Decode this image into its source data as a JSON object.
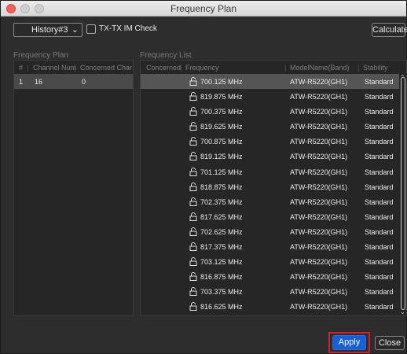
{
  "window": {
    "title": "Frequency Plan"
  },
  "toolbar": {
    "history_value": "History#3",
    "im_check_label": "TX-TX IM Check",
    "im_check_checked": false,
    "calculate_label": "Calculate"
  },
  "plan": {
    "section_label": "Frequency Plan",
    "columns": [
      "#",
      "Channel Num",
      "Concerned Channe"
    ],
    "rows": [
      {
        "index": "1",
        "channel_num": "16",
        "concerned": "0"
      }
    ]
  },
  "list": {
    "section_label": "Frequency List",
    "columns": [
      "Concerned",
      "Frequency",
      "ModelName(Band)",
      "Stability"
    ],
    "rows": [
      {
        "frequency": "700.125 MHz",
        "model": "ATW-R5220(GH1)",
        "stability": "Standard"
      },
      {
        "frequency": "819.875 MHz",
        "model": "ATW-R5220(GH1)",
        "stability": "Standard"
      },
      {
        "frequency": "700.375 MHz",
        "model": "ATW-R5220(GH1)",
        "stability": "Standard"
      },
      {
        "frequency": "819.625 MHz",
        "model": "ATW-R5220(GH1)",
        "stability": "Standard"
      },
      {
        "frequency": "700.875 MHz",
        "model": "ATW-R5220(GH1)",
        "stability": "Standard"
      },
      {
        "frequency": "819.125 MHz",
        "model": "ATW-R5220(GH1)",
        "stability": "Standard"
      },
      {
        "frequency": "701.125 MHz",
        "model": "ATW-R5220(GH1)",
        "stability": "Standard"
      },
      {
        "frequency": "818.875 MHz",
        "model": "ATW-R5220(GH1)",
        "stability": "Standard"
      },
      {
        "frequency": "702.375 MHz",
        "model": "ATW-R5220(GH1)",
        "stability": "Standard"
      },
      {
        "frequency": "817.625 MHz",
        "model": "ATW-R5220(GH1)",
        "stability": "Standard"
      },
      {
        "frequency": "702.625 MHz",
        "model": "ATW-R5220(GH1)",
        "stability": "Standard"
      },
      {
        "frequency": "817.375 MHz",
        "model": "ATW-R5220(GH1)",
        "stability": "Standard"
      },
      {
        "frequency": "703.125 MHz",
        "model": "ATW-R5220(GH1)",
        "stability": "Standard"
      },
      {
        "frequency": "816.875 MHz",
        "model": "ATW-R5220(GH1)",
        "stability": "Standard"
      },
      {
        "frequency": "703.375 MHz",
        "model": "ATW-R5220(GH1)",
        "stability": "Standard"
      },
      {
        "frequency": "816.625 MHz",
        "model": "ATW-R5220(GH1)",
        "stability": "Standard"
      }
    ],
    "selected_index": 0,
    "row_icon": "unlock-icon"
  },
  "footer": {
    "apply_label": "Apply",
    "close_label": "Close"
  },
  "colors": {
    "window_bg": "#2d2d2d",
    "panel_bg": "#262626",
    "selected_row": "#555555",
    "apply_button": "#1560d6",
    "highlight_box": "#d0202a"
  }
}
